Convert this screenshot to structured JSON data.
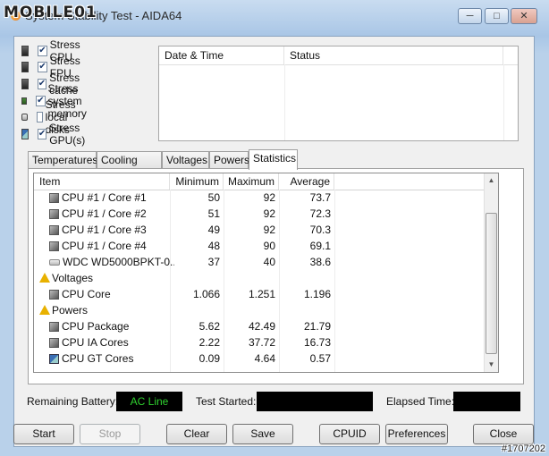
{
  "window": {
    "title": "System Stability Test - AIDA64",
    "logo_text": "MOBILE01",
    "minimize_icon": "minimize-icon",
    "maximize_icon": "maximize-icon",
    "close_icon": "close-icon"
  },
  "stress_options": [
    {
      "label": "Stress CPU",
      "checked": true,
      "icon": "cpu-icon"
    },
    {
      "label": "Stress FPU",
      "checked": true,
      "icon": "fpu-icon"
    },
    {
      "label": "Stress cache",
      "checked": true,
      "icon": "cache-icon"
    },
    {
      "label": "Stress system memory",
      "checked": true,
      "icon": "memory-icon"
    },
    {
      "label": "Stress local disks",
      "checked": false,
      "icon": "disk-icon"
    },
    {
      "label": "Stress GPU(s)",
      "checked": true,
      "icon": "gpu-icon"
    }
  ],
  "log": {
    "columns": [
      "Date & Time",
      "Status"
    ]
  },
  "tabs": [
    {
      "label": "Temperatures",
      "active": false
    },
    {
      "label": "Cooling Fans",
      "active": false
    },
    {
      "label": "Voltages",
      "active": false
    },
    {
      "label": "Powers",
      "active": false
    },
    {
      "label": "Statistics",
      "active": true
    }
  ],
  "stats": {
    "columns": [
      "Item",
      "Minimum",
      "Maximum",
      "Average"
    ],
    "rows": [
      {
        "type": "item",
        "icon": "chip",
        "item": "CPU #1 / Core #1",
        "min": "50",
        "max": "92",
        "avg": "73.7"
      },
      {
        "type": "item",
        "icon": "chip",
        "item": "CPU #1 / Core #2",
        "min": "51",
        "max": "92",
        "avg": "72.3"
      },
      {
        "type": "item",
        "icon": "chip",
        "item": "CPU #1 / Core #3",
        "min": "49",
        "max": "92",
        "avg": "70.3"
      },
      {
        "type": "item",
        "icon": "chip",
        "item": "CPU #1 / Core #4",
        "min": "48",
        "max": "90",
        "avg": "69.1"
      },
      {
        "type": "item",
        "icon": "disk",
        "item": "WDC WD5000BPKT-0...",
        "min": "37",
        "max": "40",
        "avg": "38.6"
      },
      {
        "type": "group",
        "icon": "warn",
        "item": "Voltages",
        "min": "",
        "max": "",
        "avg": ""
      },
      {
        "type": "item",
        "icon": "chip",
        "item": "CPU Core",
        "min": "1.066",
        "max": "1.251",
        "avg": "1.196"
      },
      {
        "type": "group",
        "icon": "warn",
        "item": "Powers",
        "min": "",
        "max": "",
        "avg": ""
      },
      {
        "type": "item",
        "icon": "chip",
        "item": "CPU Package",
        "min": "5.62",
        "max": "42.49",
        "avg": "21.79"
      },
      {
        "type": "item",
        "icon": "chip",
        "item": "CPU IA Cores",
        "min": "2.22",
        "max": "37.72",
        "avg": "16.73"
      },
      {
        "type": "item",
        "icon": "gpu",
        "item": "CPU GT Cores",
        "min": "0.09",
        "max": "4.64",
        "avg": "0.57"
      }
    ]
  },
  "status": {
    "battery_label": "Remaining Battery:",
    "battery_value": "AC Line",
    "test_started_label": "Test Started:",
    "test_started_value": "",
    "elapsed_label": "Elapsed Time:",
    "elapsed_value": ""
  },
  "buttons": {
    "start": "Start",
    "stop": "Stop",
    "clear": "Clear",
    "save": "Save",
    "cpuid": "CPUID",
    "preferences": "Preferences",
    "close": "Close"
  },
  "watermark": "#1707202",
  "colors": {
    "battery_text": "#2fd12f",
    "status_box": "#000000"
  }
}
